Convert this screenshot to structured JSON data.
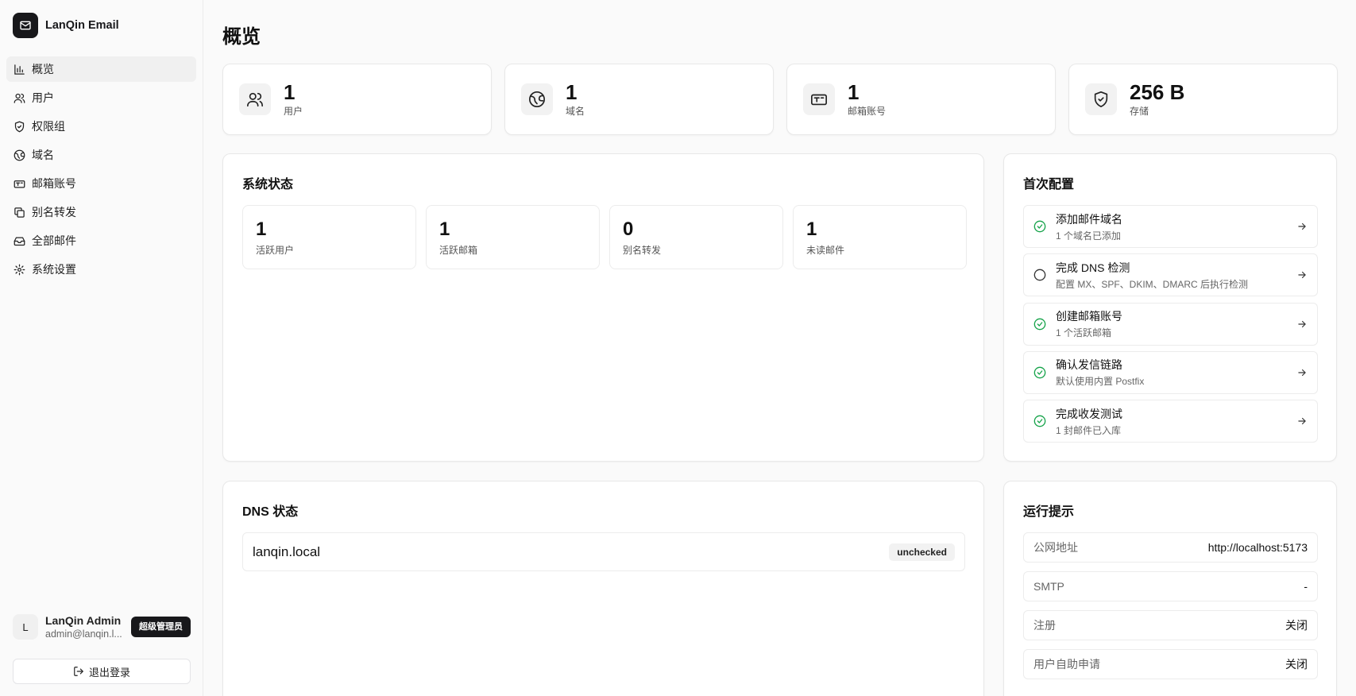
{
  "app": {
    "name": "LanQin Email"
  },
  "sidebar": {
    "items": [
      {
        "label": "概览",
        "icon": "bar-chart-icon",
        "active": true
      },
      {
        "label": "用户",
        "icon": "users-icon",
        "active": false
      },
      {
        "label": "权限组",
        "icon": "shield-icon",
        "active": false
      },
      {
        "label": "域名",
        "icon": "globe-icon",
        "active": false
      },
      {
        "label": "邮箱账号",
        "icon": "mailbox-icon",
        "active": false
      },
      {
        "label": "别名转发",
        "icon": "copy-icon",
        "active": false
      },
      {
        "label": "全部邮件",
        "icon": "inbox-icon",
        "active": false
      },
      {
        "label": "系统设置",
        "icon": "gear-icon",
        "active": false
      }
    ]
  },
  "user": {
    "initial": "L",
    "name": "LanQin Admin",
    "email": "admin@lanqin.l...",
    "role": "超级管理员",
    "logout_label": "退出登录"
  },
  "page": {
    "title": "概览"
  },
  "stats": [
    {
      "value": "1",
      "label": "用户",
      "icon": "users-icon"
    },
    {
      "value": "1",
      "label": "域名",
      "icon": "globe-icon"
    },
    {
      "value": "1",
      "label": "邮箱账号",
      "icon": "mailbox-icon"
    },
    {
      "value": "256 B",
      "label": "存储",
      "icon": "shield-check-icon"
    }
  ],
  "system_status": {
    "title": "系统状态",
    "items": [
      {
        "value": "1",
        "label": "活跃用户"
      },
      {
        "value": "1",
        "label": "活跃邮箱"
      },
      {
        "value": "0",
        "label": "别名转发"
      },
      {
        "value": "1",
        "label": "未读邮件"
      }
    ]
  },
  "setup": {
    "title": "首次配置",
    "items": [
      {
        "title": "添加邮件域名",
        "desc": "1 个域名已添加",
        "done": true
      },
      {
        "title": "完成 DNS 检测",
        "desc": "配置 MX、SPF、DKIM、DMARC 后执行检测",
        "done": false
      },
      {
        "title": "创建邮箱账号",
        "desc": "1 个活跃邮箱",
        "done": true
      },
      {
        "title": "确认发信链路",
        "desc": "默认使用内置 Postfix",
        "done": true
      },
      {
        "title": "完成收发测试",
        "desc": "1 封邮件已入库",
        "done": true
      }
    ]
  },
  "dns": {
    "title": "DNS 状态",
    "rows": [
      {
        "domain": "lanqin.local",
        "status": "unchecked"
      }
    ]
  },
  "runtime": {
    "title": "运行提示",
    "rows": [
      {
        "label": "公网地址",
        "value": "http://localhost:5173"
      },
      {
        "label": "SMTP",
        "value": "-"
      },
      {
        "label": "注册",
        "value": "关闭"
      },
      {
        "label": "用户自助申请",
        "value": "关闭"
      }
    ]
  },
  "colors": {
    "accent": "#18181b",
    "success": "#16a34a",
    "border": "#e8e8e8"
  }
}
